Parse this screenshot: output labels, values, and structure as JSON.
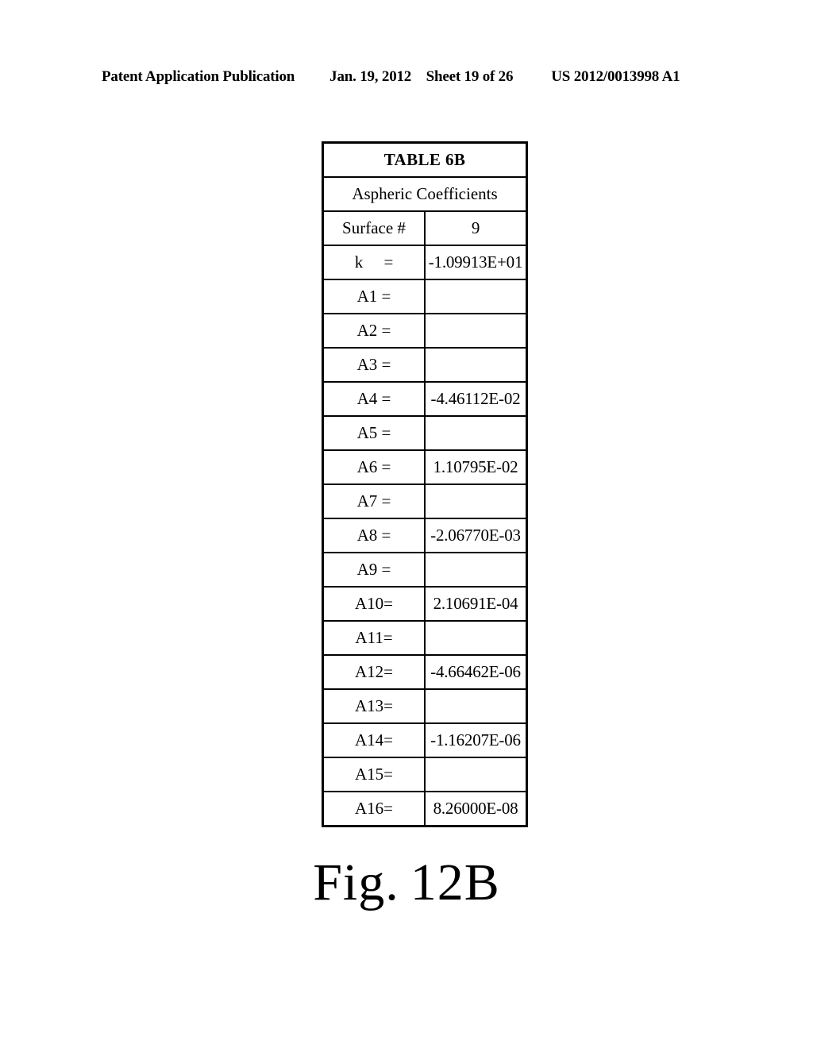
{
  "header": {
    "publication": "Patent Application Publication",
    "date": "Jan. 19, 2012",
    "sheet": "Sheet 19 of 26",
    "patent_number": "US 2012/0013998 A1"
  },
  "table": {
    "title": "TABLE 6B",
    "subtitle": "Aspheric Coefficients",
    "surface_label": "Surface #",
    "surface_value": "9",
    "rows": [
      {
        "label": "k     =",
        "value": "-1.09913E+01"
      },
      {
        "label": "A1 =",
        "value": ""
      },
      {
        "label": "A2 =",
        "value": ""
      },
      {
        "label": "A3 =",
        "value": ""
      },
      {
        "label": "A4 =",
        "value": "-4.46112E-02"
      },
      {
        "label": "A5 =",
        "value": ""
      },
      {
        "label": "A6 =",
        "value": "1.10795E-02"
      },
      {
        "label": "A7 =",
        "value": ""
      },
      {
        "label": "A8 =",
        "value": "-2.06770E-03"
      },
      {
        "label": "A9 =",
        "value": ""
      },
      {
        "label": "A10=",
        "value": "2.10691E-04"
      },
      {
        "label": "A11=",
        "value": ""
      },
      {
        "label": "A12=",
        "value": "-4.66462E-06"
      },
      {
        "label": "A13=",
        "value": ""
      },
      {
        "label": "A14=",
        "value": "-1.16207E-06"
      },
      {
        "label": "A15=",
        "value": ""
      },
      {
        "label": "A16=",
        "value": "8.26000E-08"
      }
    ]
  },
  "figure": {
    "prefix": "Fig.",
    "number": "12B"
  }
}
